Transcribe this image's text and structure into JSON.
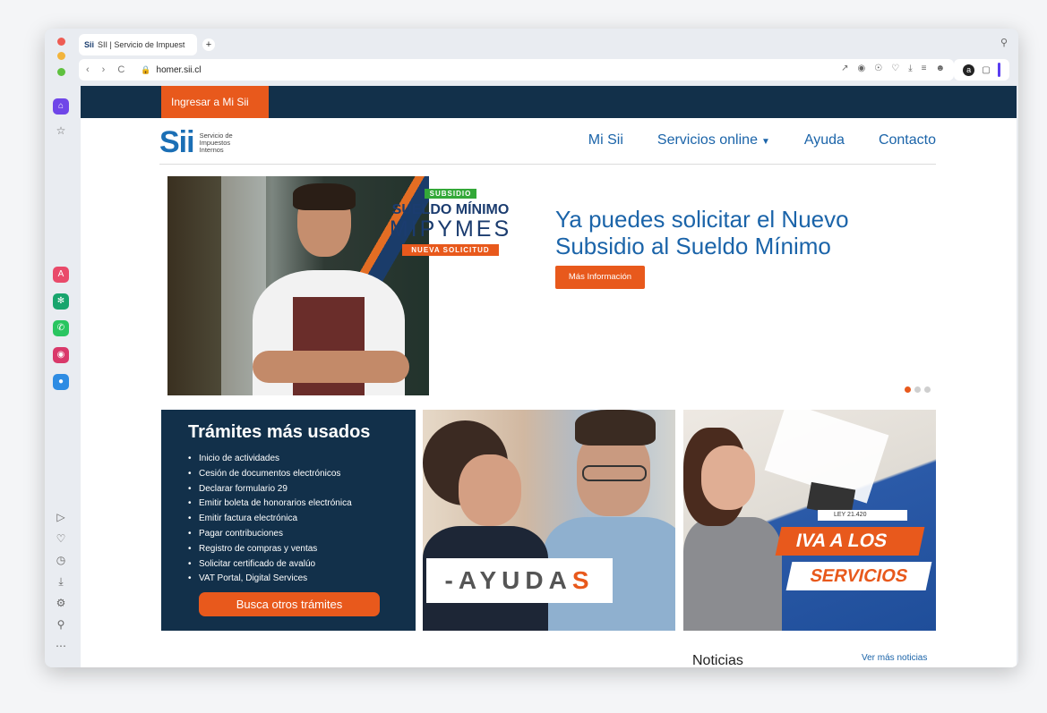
{
  "browser": {
    "tab_favicon": "Sii",
    "tab_title": "SII | Servicio de Impuest",
    "new_tab": "+",
    "url": "homer.sii.cl",
    "nav": {
      "back": "‹",
      "forward": "›",
      "reload": "C"
    }
  },
  "site": {
    "login_label": "Ingresar a Mi Sii",
    "logo": {
      "mark": "Sii",
      "line1": "Servicio de",
      "line2": "Impuestos",
      "line3": "Internos"
    },
    "nav": {
      "item1": "Mi Sii",
      "item2": "Servicios online",
      "item3": "Ayuda",
      "item4": "Contacto"
    }
  },
  "hero": {
    "badge_top": "SUBSIDIO",
    "badge_line1": "SUELDO MÍNIMO",
    "badge_line2": "MIPYMES",
    "badge_bottom": "NUEVA SOLICITUD",
    "title": "Ya puedes solicitar el Nuevo Subsidio al Sueldo Mínimo",
    "button": "Más Información"
  },
  "tramites": {
    "title": "Trámites más usados",
    "items": [
      "Inicio de actividades",
      "Cesión de documentos electrónicos",
      "Declarar formulario 29",
      "Emitir boleta de honorarios electrónica",
      "Emitir factura electrónica",
      "Pagar contribuciones",
      "Registro de compras y ventas",
      "Solicitar certificado de avalúo",
      "VAT Portal, Digital Services"
    ],
    "button": "Busca otros trámites"
  },
  "ayudas": {
    "label_main": "-AYUDA",
    "label_accent": "S"
  },
  "iva": {
    "ley": "LEY 21.420",
    "line1": "IVA A LOS",
    "line2": "SERVICIOS"
  },
  "news": {
    "title": "Noticias",
    "more": "Ver más noticias"
  },
  "colors": {
    "navy": "#12304a",
    "orange": "#e8591c",
    "blue_link": "#1b64a9"
  }
}
